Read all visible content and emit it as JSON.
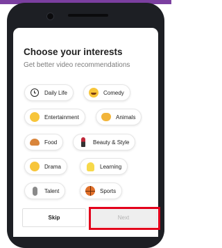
{
  "colors": {
    "accent_top_bar": "#7b3fa0",
    "highlight_box": "#e3001b",
    "phone_frame": "#1d1f24"
  },
  "header": {
    "title": "Choose your interests",
    "subtitle": "Get better video recommendations"
  },
  "interests": [
    {
      "label": "Daily Life",
      "icon": "clock-icon"
    },
    {
      "label": "Comedy",
      "icon": "laughing-face-icon"
    },
    {
      "label": "Entertainment",
      "icon": "party-face-icon"
    },
    {
      "label": "Animals",
      "icon": "cat-face-icon"
    },
    {
      "label": "Food",
      "icon": "burger-icon"
    },
    {
      "label": "Beauty & Style",
      "icon": "lipstick-icon"
    },
    {
      "label": "Drama",
      "icon": "drama-face-icon"
    },
    {
      "label": "Learning",
      "icon": "light-bulb-icon"
    },
    {
      "label": "Talent",
      "icon": "microphone-icon"
    },
    {
      "label": "Sports",
      "icon": "basketball-icon"
    }
  ],
  "footer": {
    "skip_label": "Skip",
    "next_label": "Next"
  }
}
